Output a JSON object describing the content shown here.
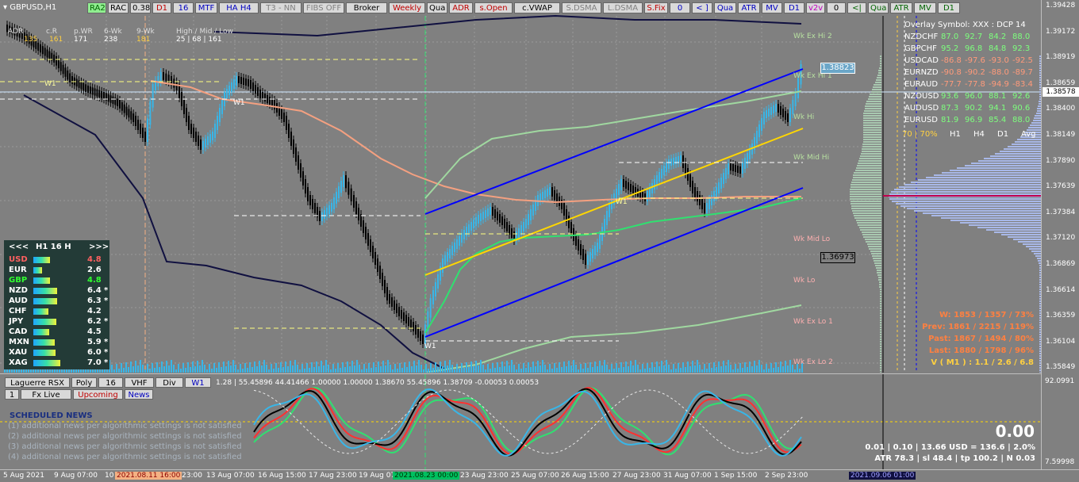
{
  "symbol": "GBPUSD,H1",
  "toolbar": [
    {
      "label": "RA2",
      "color": "#006400",
      "bg": "#90ee90"
    },
    {
      "label": "RAC",
      "color": "#000000",
      "bg": "#d9d9d9"
    },
    {
      "label": "0.38",
      "color": "#000000",
      "bg": "#d9d9d9"
    },
    {
      "label": "D1",
      "color": "#c00000",
      "bg": "#d9d9d9"
    },
    {
      "label": "16",
      "color": "#0000c0",
      "bg": "#d9d9d9"
    },
    {
      "label": "MTF",
      "color": "#0000c0",
      "bg": "#d9d9d9"
    },
    {
      "label": "HA H4",
      "color": "#0000c0",
      "bg": "#d9d9d9"
    },
    {
      "label": "T3 - NN",
      "color": "#808080",
      "bg": "#d9d9d9"
    },
    {
      "label": "FIBS OFF",
      "color": "#808080",
      "bg": "#d9d9d9"
    },
    {
      "label": "Broker",
      "color": "#000000",
      "bg": "#d9d9d9"
    },
    {
      "label": "Weekly",
      "color": "#c00000",
      "bg": "#d9d9d9"
    },
    {
      "label": "Qua",
      "color": "#000000",
      "bg": "#d9d9d9"
    },
    {
      "label": "ADR",
      "color": "#c00000",
      "bg": "#d9d9d9"
    },
    {
      "label": "s.Open",
      "color": "#c00000",
      "bg": "#d9d9d9"
    },
    {
      "label": "c.VWAP",
      "color": "#000000",
      "bg": "#d9d9d9"
    },
    {
      "label": "S.DSMA",
      "color": "#808080",
      "bg": "#d9d9d9"
    },
    {
      "label": "L.DSMA",
      "color": "#808080",
      "bg": "#d9d9d9"
    },
    {
      "label": "S.Fix",
      "color": "#c00000",
      "bg": "#d9d9d9"
    },
    {
      "label": "0",
      "color": "#0000c0",
      "bg": "#d9d9d9"
    },
    {
      "label": "< ]",
      "color": "#0000c0",
      "bg": "#d9d9d9"
    },
    {
      "label": "Qua",
      "color": "#0000c0",
      "bg": "#d9d9d9"
    },
    {
      "label": "ATR",
      "color": "#0000c0",
      "bg": "#d9d9d9"
    },
    {
      "label": "MV",
      "color": "#0000c0",
      "bg": "#d9d9d9"
    },
    {
      "label": "D1",
      "color": "#0000c0",
      "bg": "#d9d9d9"
    },
    {
      "label": "v2v",
      "color": "#c000c0",
      "bg": "#d9d9d9"
    },
    {
      "label": "0",
      "color": "#000000",
      "bg": "#d9d9d9"
    },
    {
      "label": "<|",
      "color": "#006400",
      "bg": "#d9d9d9"
    },
    {
      "label": "Qua",
      "color": "#006400",
      "bg": "#d9d9d9"
    },
    {
      "label": "ATR",
      "color": "#006400",
      "bg": "#d9d9d9"
    },
    {
      "label": "MV",
      "color": "#006400",
      "bg": "#d9d9d9"
    },
    {
      "label": "D1",
      "color": "#006400",
      "bg": "#d9d9d9"
    }
  ],
  "header_stats": {
    "labels": [
      "ADR",
      "c.R",
      "p.WR",
      "6-Wk",
      "9-Wk",
      "High / Mid / Low"
    ],
    "values": [
      "135",
      "161",
      "171",
      "238",
      "181",
      "25  |  68  |  161"
    ]
  },
  "strength_panel": {
    "header": {
      "prev": "<<<",
      "title": "H1  16  H",
      "next": ">>>"
    },
    "rows": [
      {
        "cur": "USD",
        "val": "4.8",
        "color": "#ff6060",
        "star": ""
      },
      {
        "cur": "EUR",
        "val": "2.6",
        "color": "#ffffff",
        "star": ""
      },
      {
        "cur": "GBP",
        "val": "4.8",
        "color": "#30ff30",
        "star": ""
      },
      {
        "cur": "NZD",
        "val": "6.4",
        "color": "#ffffff",
        "star": "*"
      },
      {
        "cur": "AUD",
        "val": "6.3",
        "color": "#ffffff",
        "star": "*"
      },
      {
        "cur": "CHF",
        "val": "4.2",
        "color": "#ffffff",
        "star": ""
      },
      {
        "cur": "JPY",
        "val": "6.2",
        "color": "#ffffff",
        "star": "*"
      },
      {
        "cur": "CAD",
        "val": "4.5",
        "color": "#ffffff",
        "star": ""
      },
      {
        "cur": "MXN",
        "val": "5.9",
        "color": "#ffffff",
        "star": "*"
      },
      {
        "cur": "XAU",
        "val": "6.0",
        "color": "#ffffff",
        "star": "*"
      },
      {
        "cur": "XAG",
        "val": "7.0",
        "color": "#ffffff",
        "star": "*"
      }
    ]
  },
  "overlay": {
    "title": "Overlay Symbol: XXX : DCP 14",
    "rows": [
      {
        "pair": "NZDCHF",
        "v": [
          "87.0",
          "92.7",
          "84.2",
          "88.0"
        ],
        "color": "#7dff7d"
      },
      {
        "pair": "GBPCHF",
        "v": [
          "95.2",
          "96.8",
          "84.8",
          "92.3"
        ],
        "color": "#7dff7d"
      },
      {
        "pair": "USDCAD",
        "v": [
          "-86.8",
          "-97.6",
          "-93.0",
          "-92.5"
        ],
        "color": "#ff9a7a"
      },
      {
        "pair": "EURNZD",
        "v": [
          "-90.8",
          "-90.2",
          "-88.0",
          "-89.7"
        ],
        "color": "#ff9a7a"
      },
      {
        "pair": "EURAUD",
        "v": [
          "-77.7",
          "-77.8",
          "-94.9",
          "-83.4"
        ],
        "color": "#ff9a7a"
      },
      {
        "pair": "NZDUSD",
        "v": [
          "93.6",
          "96.0",
          "88.1",
          "92.6"
        ],
        "color": "#7dff7d"
      },
      {
        "pair": "AUDUSD",
        "v": [
          "87.3",
          "90.2",
          "94.1",
          "90.6"
        ],
        "color": "#7dff7d"
      },
      {
        "pair": "EURUSD",
        "v": [
          "81.9",
          "96.9",
          "85.4",
          "88.0"
        ],
        "color": "#7dff7d"
      }
    ],
    "footer": {
      "pct": "70  |  70%",
      "cols": [
        "H1",
        "H4",
        "D1",
        "Avg"
      ]
    }
  },
  "level_labels": [
    {
      "text": "Wk Ex Hi 2",
      "color": "#b7e0a0"
    },
    {
      "text": "Wk Ex Hi 1",
      "color": "#b7e0a0"
    },
    {
      "text": "Wk Hi",
      "color": "#b7e0a0"
    },
    {
      "text": "Wk Mid Hi",
      "color": "#b7e0a0"
    },
    {
      "text": "Wk Mid Lo",
      "color": "#ffb0b0"
    },
    {
      "text": "Wk Lo",
      "color": "#ffb0b0"
    },
    {
      "text": "Wk Ex Lo 1",
      "color": "#ffb0b0"
    },
    {
      "text": "Wk Ex Lo 2",
      "color": "#ffb0b0"
    }
  ],
  "price_boxes": {
    "upper": "1.38823",
    "lower": "1.36973",
    "current": "1.38578"
  },
  "w1_labels": [
    "W1",
    "W1",
    "W1",
    "W1"
  ],
  "stats_right": [
    {
      "text": "W: 1853 / 1357 / 73%",
      "color": "#ff8040"
    },
    {
      "text": "Prev: 1861 / 2215 / 119%",
      "color": "#ff8040"
    },
    {
      "text": "Past: 1867 / 1494 / 80%",
      "color": "#ff8040"
    },
    {
      "text": "Last: 1880 / 1798 / 96%",
      "color": "#ff8040"
    },
    {
      "text": "V ( M1 ) : 1.1 / 2.6 / 6.8",
      "color": "#ffd040"
    }
  ],
  "price_ticks": [
    "1.39428",
    "1.39172",
    "1.38919",
    "1.38659",
    "1.38400",
    "1.38149",
    "1.37890",
    "1.37639",
    "1.37384",
    "1.37120",
    "1.36869",
    "1.36614",
    "1.36359",
    "1.36104",
    "1.35849"
  ],
  "sub_ticks": [
    "92.0991",
    "7.59998"
  ],
  "sub_tabs": [
    {
      "label": "Laguerre RSX",
      "color": "#000000"
    },
    {
      "label": "Poly",
      "color": "#000000"
    },
    {
      "label": "16",
      "color": "#000000"
    },
    {
      "label": "VHF",
      "color": "#000000"
    },
    {
      "label": "Div",
      "color": "#000000"
    },
    {
      "label": "W1",
      "color": "#0000c0"
    }
  ],
  "sub_tabs2": [
    {
      "label": "1",
      "color": "#000000"
    },
    {
      "label": "Fx Live",
      "color": "#000000"
    },
    {
      "label": "Upcoming",
      "color": "#c00000"
    },
    {
      "label": "News",
      "color": "#0000c0"
    }
  ],
  "sub_values": "1.28 | 55.45896 44.41466 1.00000 1.00000 1.38670 55.45896 1.38709 -0.00053 0.00053",
  "news": {
    "title": "SCHEDULED NEWS",
    "lines": [
      "(1) additional news per algorithmic settings is not satisfied",
      "(2) additional news per algorithmic settings is not satisfied",
      "(3) additional news per algorithmic settings is not satisfied",
      "(4) additional news per algorithmic settings is not satisfied"
    ]
  },
  "pnl": {
    "big": "0.00",
    "line1": "0.01  |  0.10  |  13.66 USD = 136.6  |  2.0%",
    "line2": "ATR 78.3  | sl 48.4  |  tp 100.2  |  N 0.03"
  },
  "time_ticks": [
    {
      "text": "5 Aug 2021",
      "hl": false
    },
    {
      "text": "9 Aug 07:00",
      "hl": false
    },
    {
      "text": "10",
      "hl": false
    },
    {
      "text": "2021.08.11 16:00",
      "hl": "orange"
    },
    {
      "text": "23:00",
      "hl": false
    },
    {
      "text": "13 Aug 07:00",
      "hl": false
    },
    {
      "text": "16 Aug 15:00",
      "hl": false
    },
    {
      "text": "17 Aug 23:00",
      "hl": false
    },
    {
      "text": "19 Aug 07",
      "hl": false
    },
    {
      "text": "2021.08.23 00:00",
      "hl": "green"
    },
    {
      "text": "23 Aug 23:00",
      "hl": false
    },
    {
      "text": "25 Aug 07:00",
      "hl": false
    },
    {
      "text": "26 Aug 15:00",
      "hl": false
    },
    {
      "text": "27 Aug 23:00",
      "hl": false
    },
    {
      "text": "31 Aug 07:00",
      "hl": false
    },
    {
      "text": "1 Sep 15:00",
      "hl": false
    },
    {
      "text": "2 Sep 23:00",
      "hl": false
    },
    {
      "text": "2021.09.06 01:00",
      "hl": "navy"
    }
  ],
  "colors": {
    "bg": "#808080",
    "bull": "#38b6e8",
    "bear": "#000000",
    "channel": "#0000ff",
    "trend": "#ffd700"
  }
}
